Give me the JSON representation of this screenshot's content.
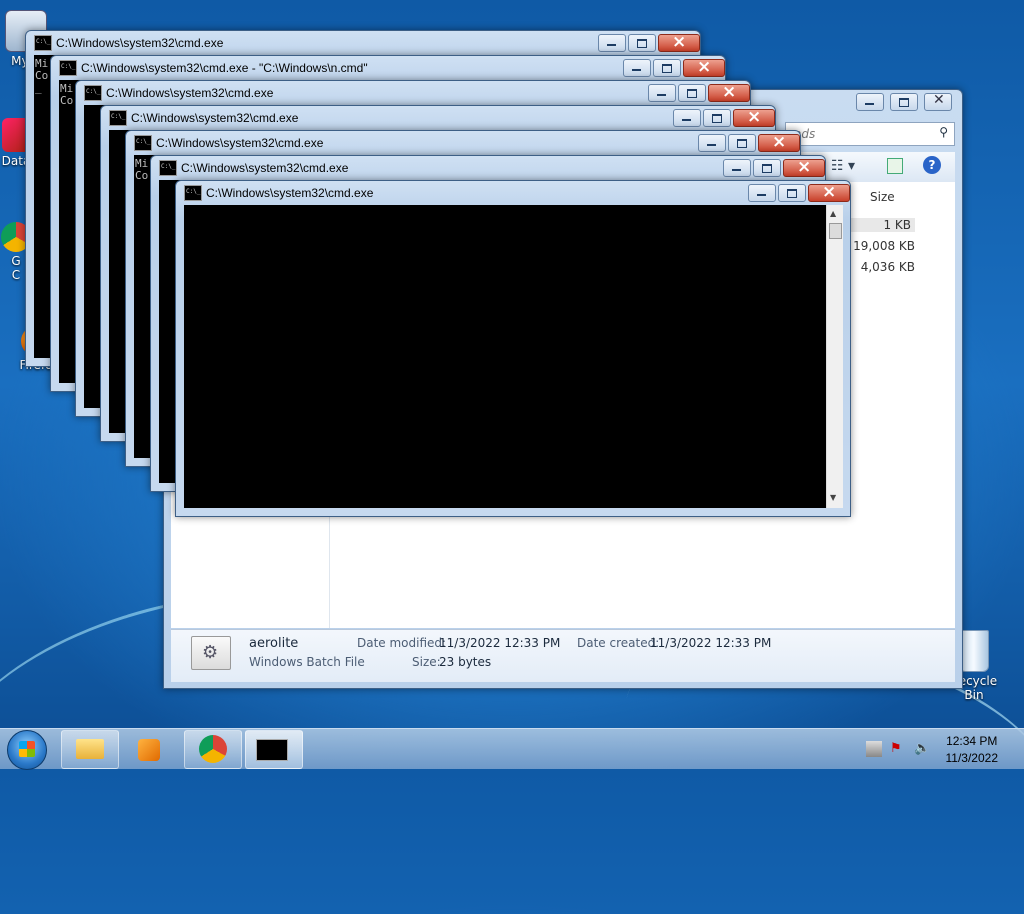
{
  "desktop": {
    "icons": [
      {
        "label": "My C"
      },
      {
        "label": "Data"
      },
      {
        "label": "G"
      },
      {
        "label": "C"
      },
      {
        "label": "Firefo"
      },
      {
        "label": "Recycle Bin"
      }
    ]
  },
  "explorer": {
    "search_placeholder": "ads",
    "sizes": [
      "Size",
      "1 KB",
      "19,008 KB",
      "4,036 KB"
    ],
    "details": {
      "filename": "aerolite",
      "filetype": "Windows Batch File",
      "date_modified_label": "Date modified:",
      "date_modified": "11/3/2022 12:33 PM",
      "date_created_label": "Date created:",
      "date_created": "11/3/2022 12:33 PM",
      "size_label": "Size:",
      "size": "23 bytes"
    }
  },
  "cmd_windows": [
    {
      "title": "C:\\Windows\\system32\\cmd.exe"
    },
    {
      "title": "C:\\Windows\\system32\\cmd.exe - \"C:\\Windows\\n.cmd\""
    },
    {
      "title": "C:\\Windows\\system32\\cmd.exe"
    },
    {
      "title": "C:\\Windows\\system32\\cmd.exe"
    },
    {
      "title": "C:\\Windows\\system32\\cmd.exe"
    },
    {
      "title": "C:\\Windows\\system32\\cmd.exe"
    },
    {
      "title": "C:\\Windows\\system32\\cmd.exe"
    }
  ],
  "console_snippets": {
    "w0": [
      "Mi",
      "Co",
      "_"
    ],
    "w1": [
      "Mi",
      "Co"
    ],
    "w4": [
      "Mi",
      "Co"
    ]
  },
  "taskbar": {
    "time": "12:34 PM",
    "date": "11/3/2022"
  }
}
